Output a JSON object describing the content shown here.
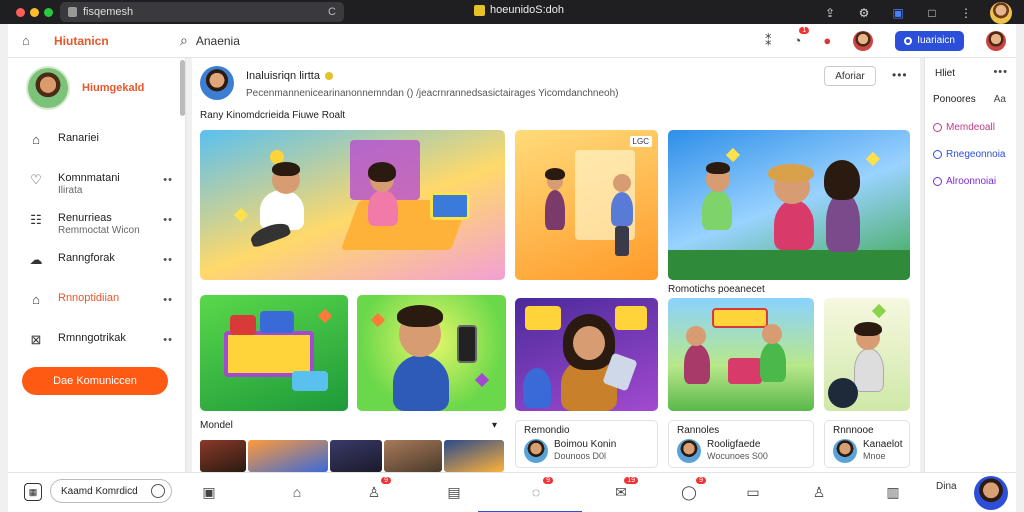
{
  "browser": {
    "url": "fisqemesh",
    "tab_title": "hoeunidoS:doh",
    "colors": {
      "chrome_bg": "#1f1f22",
      "red": "#ff5f57",
      "yellow": "#febc2e",
      "green": "#28c840"
    }
  },
  "topbar": {
    "brand": "Hiutanicn",
    "search_text": "Anaenia",
    "notif_badge": "1",
    "primary_button": "Iuariaicn"
  },
  "sidebar": {
    "profile_name": "Hiumgekald",
    "items": [
      {
        "label": "Ranariei",
        "sub": ""
      },
      {
        "label": "Komnmatani",
        "sub": "Ilirata"
      },
      {
        "label": "Renurrieas",
        "sub": "Remmoctat Wicon"
      },
      {
        "label": "Ranngforak",
        "sub": ""
      },
      {
        "label": "Rnnoptidiian",
        "sub": ""
      },
      {
        "label": "Rmnngotrikak",
        "sub": ""
      }
    ],
    "join_button": "Dae Komuniccen",
    "accent": "#ff5a14"
  },
  "main": {
    "channel_title": "Inaluisriqn lirtta",
    "channel_desc": "Pecenmannenicearinanonnemndan () /jeacrnrannedsasictairages Yicomdanchneoh)",
    "follow_button": "Aforiar",
    "section1": "Rany Kinomdcrieida Fiuwe Roalt",
    "badge": "LGC",
    "section2_label": "Romotichs poeanecet",
    "section3": "Mondel",
    "section3_more": "▾",
    "cards": [
      {
        "title": "Remondio",
        "name": "Boimou Konin",
        "sub": "Dounoos D0l"
      },
      {
        "title": "Rannoles",
        "name": "Rooligfaede",
        "sub": "Wocunoes S00"
      },
      {
        "title": "Rnnnooe",
        "name": "Kanaelot",
        "sub": "Mnoe"
      }
    ]
  },
  "rpanel": {
    "title": "Hliet",
    "sort_label": "Ponoores",
    "sort_value": "Aa",
    "items": [
      {
        "label": "Memdeoall",
        "color": "#c03a8c"
      },
      {
        "label": "Rnegeonnoia",
        "color": "#2b4fd9"
      },
      {
        "label": "Alroonnoiai",
        "color": "#7b2bd9"
      }
    ]
  },
  "dock": {
    "search_text": "Kaamd Komrdicd",
    "badges": [
      "9",
      "9",
      "9",
      "19",
      "9",
      "9"
    ],
    "me_label": "Dina"
  },
  "icons": {
    "home": "house-outline-icon",
    "search": "magnifier-icon",
    "bell": "bell-icon",
    "grid": "grid-icon"
  }
}
